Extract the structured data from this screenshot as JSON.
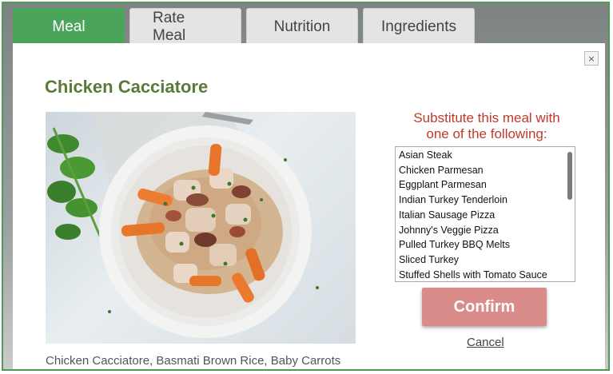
{
  "tabs": [
    {
      "label": "Meal",
      "active": true
    },
    {
      "label": "Rate Meal",
      "active": false
    },
    {
      "label": "Nutrition",
      "active": false
    },
    {
      "label": "Ingredients",
      "active": false
    }
  ],
  "modal": {
    "close_icon": "×",
    "title": "Chicken Cacciatore",
    "caption": "Chicken Cacciatore, Basmati Brown Rice, Baby Carrots",
    "substitute_heading_line1": "Substitute this meal with",
    "substitute_heading_line2": "one of the following:",
    "options": [
      "Asian Steak",
      "Chicken Parmesan",
      "Eggplant Parmesan",
      "Indian Turkey Tenderloin",
      "Italian Sausage Pizza",
      "Johnny's Veggie Pizza",
      "Pulled Turkey BBQ Melts",
      "Sliced Turkey",
      "Stuffed Shells with Tomato Sauce"
    ],
    "confirm_label": "Confirm",
    "cancel_label": "Cancel"
  },
  "colors": {
    "active_tab": "#4aa45a",
    "title": "#5a7a3a",
    "heading": "#c0392b",
    "confirm": "#d98c8a"
  }
}
